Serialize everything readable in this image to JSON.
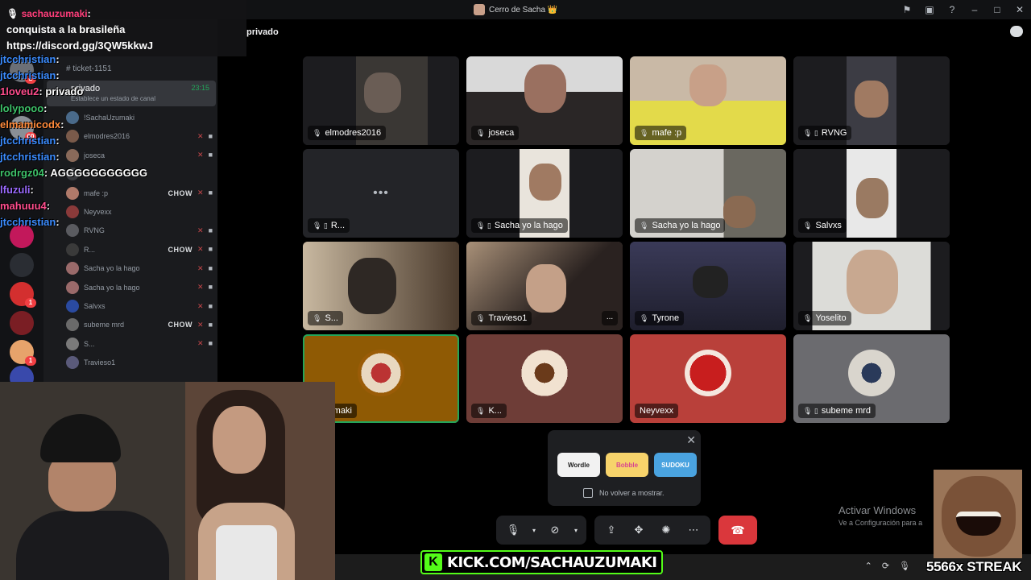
{
  "window": {
    "title": "Cerro de Sacha 👑"
  },
  "chat_overlay": {
    "username": "sachauzumaki",
    "message_line1": "conquista a la brasileña",
    "message_line2": "https://discord.gg/3QW5kkwJ"
  },
  "stream_chat": [
    {
      "user": "jtcchristian",
      "msg": ":",
      "color": "blue"
    },
    {
      "user": "jtcchristian",
      "msg": ":",
      "color": "blue"
    },
    {
      "user": "1loveu2",
      "msg": ": privado",
      "color": "pink"
    },
    {
      "user": "lolypooo",
      "msg": ":",
      "color": "green"
    },
    {
      "user": "elmamicodx",
      "msg": ":",
      "color": "orange"
    },
    {
      "user": "jtcchristian",
      "msg": ":",
      "color": "blue"
    },
    {
      "user": "jtcchristian",
      "msg": ":",
      "color": "blue"
    },
    {
      "user": "rodrgz04",
      "msg": ": AGGGGGGGGGGG",
      "color": "green"
    },
    {
      "user": "lfuzuli",
      "msg": ":",
      "color": "purple"
    },
    {
      "user": "mahuuu4",
      "msg": ":",
      "color": "pink"
    },
    {
      "user": "jtcchristian",
      "msg": ":",
      "color": "blue"
    }
  ],
  "sidebar": {
    "ticket_channel": "ticket-1151",
    "selected_channel": {
      "name": "privado",
      "time": "23:15",
      "status": "Establece un estado de canal"
    },
    "members": [
      {
        "name": "!SachaUzumaki",
        "tag": "",
        "muted": false
      },
      {
        "name": "elmodres2016",
        "tag": "",
        "muted": true
      },
      {
        "name": "joseca",
        "tag": "",
        "muted": true
      },
      {
        "name": "",
        "tag": "",
        "muted": false
      },
      {
        "name": "mafe :p",
        "tag": "CHOW",
        "muted": true
      },
      {
        "name": "Neyvexx",
        "tag": "",
        "muted": false
      },
      {
        "name": "RVNG",
        "tag": "",
        "muted": true
      },
      {
        "name": "R...",
        "tag": "CHOW",
        "muted": true
      },
      {
        "name": "Sacha yo la hago",
        "tag": "",
        "muted": true
      },
      {
        "name": "Sacha yo la hago",
        "tag": "",
        "muted": true
      },
      {
        "name": "Salvxs",
        "tag": "",
        "muted": true
      },
      {
        "name": "subeme mrd",
        "tag": "CHOW",
        "muted": true
      },
      {
        "name": "S...",
        "tag": "",
        "muted": true
      },
      {
        "name": "Travieso1",
        "tag": "",
        "muted": false
      }
    ],
    "server_badges": [
      "2",
      "60",
      "1",
      "1"
    ]
  },
  "main": {
    "channel_name": "privado",
    "tiles": [
      {
        "name": "elmodres2016"
      },
      {
        "name": "joseca"
      },
      {
        "name": "mafe :p"
      },
      {
        "name": "RVNG"
      },
      {
        "name": "R..."
      },
      {
        "name": "Sacha yo la hago"
      },
      {
        "name": "Sacha yo la hago"
      },
      {
        "name": "Salvxs"
      },
      {
        "name": "S..."
      },
      {
        "name": "Travieso1"
      },
      {
        "name": "Tyrone"
      },
      {
        "name": "Yoselito"
      },
      {
        "name": "aUzumaki"
      },
      {
        "name": "K..."
      },
      {
        "name": "Neyvexx"
      },
      {
        "name": "subeme mrd"
      }
    ],
    "tile_more": "...",
    "placeholder_dots": "•••"
  },
  "activity_popup": {
    "apps": [
      "Wordle",
      "Bobble",
      "SUDOKU"
    ],
    "checkbox_label": "No volver a mostrar."
  },
  "controls": {
    "more": "⋯"
  },
  "windows_watermark": {
    "line1": "Activar Windows",
    "line2": "Ve a Configuración para a"
  },
  "overlays": {
    "kick_logo": "K",
    "kick_url": "KICK.COM/SACHAUZUMAKI",
    "streak": "5566x STREAK"
  },
  "colors": {
    "accent_green": "#53fc18",
    "hangup_red": "#da373c",
    "speaking_green": "#23a55a"
  }
}
